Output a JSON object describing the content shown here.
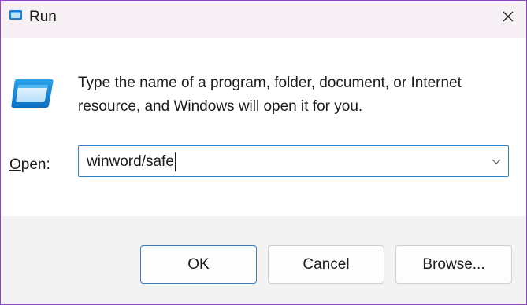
{
  "window": {
    "title": "Run",
    "close_glyph": "✕",
    "border_color": "#8f46c8"
  },
  "icons": {
    "app": "run-app-icon",
    "main": "run-program-icon",
    "close": "close-icon",
    "dropdown": "chevron-down-icon"
  },
  "description": "Type the name of a program, folder, document, or Internet resource, and Windows will open it for you.",
  "open_field": {
    "label_prefix": "O",
    "label_rest": "pen:",
    "value": "winword/safe"
  },
  "buttons": {
    "ok": "OK",
    "cancel": "Cancel",
    "browse_underlined": "B",
    "browse_rest": "rowse..."
  },
  "colors": {
    "accent": "#2f84cc",
    "footer_bg": "#f3f3f3"
  }
}
